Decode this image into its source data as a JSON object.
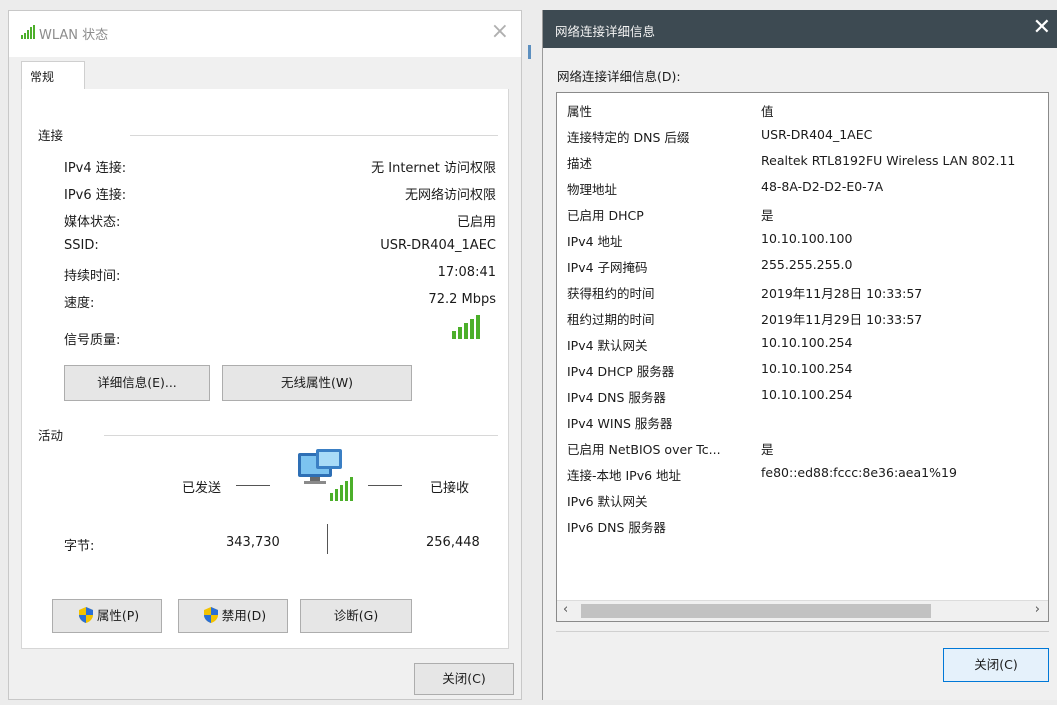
{
  "left_window": {
    "title": "WLAN 状态",
    "close_glyph": "×",
    "tab": "常规",
    "connection_section": "连接",
    "connection_rows": [
      {
        "label": "IPv4 连接:",
        "value": "无 Internet 访问权限"
      },
      {
        "label": "IPv6 连接:",
        "value": "无网络访问权限"
      },
      {
        "label": "媒体状态:",
        "value": "已启用"
      },
      {
        "label": "SSID:",
        "value": "USR-DR404_1AEC"
      },
      {
        "label": "持续时间:",
        "value": "17:08:41"
      },
      {
        "label": "速度:",
        "value": "72.2 Mbps"
      }
    ],
    "signal_label": "信号质量:",
    "signal_bars": 5,
    "details_button": "详细信息(E)...",
    "wireless_props_button": "无线属性(W)",
    "activity_section": "活动",
    "sent_label": "已发送",
    "received_label": "已接收",
    "bytes_label": "字节:",
    "bytes_sent": "343,730",
    "bytes_received": "256,448",
    "properties_button": "属性(P)",
    "disable_button": "禁用(D)",
    "diagnose_button": "诊断(G)",
    "close_button": "关闭(C)"
  },
  "right_window": {
    "title": "网络连接详细信息",
    "close_glyph": "✕",
    "group_label": "网络连接详细信息(D):",
    "rows": [
      {
        "prop": "属性",
        "value": "值"
      },
      {
        "prop": "连接特定的 DNS 后缀",
        "value": "USR-DR404_1AEC"
      },
      {
        "prop": "描述",
        "value": "Realtek RTL8192FU Wireless LAN 802.11"
      },
      {
        "prop": "物理地址",
        "value": "48-8A-D2-D2-E0-7A"
      },
      {
        "prop": "已启用 DHCP",
        "value": "是"
      },
      {
        "prop": "IPv4 地址",
        "value": "10.10.100.100"
      },
      {
        "prop": "IPv4 子网掩码",
        "value": "255.255.255.0"
      },
      {
        "prop": "获得租约的时间",
        "value": "2019年11月28日 10:33:57"
      },
      {
        "prop": "租约过期的时间",
        "value": "2019年11月29日 10:33:57"
      },
      {
        "prop": "IPv4 默认网关",
        "value": "10.10.100.254"
      },
      {
        "prop": "IPv4 DHCP 服务器",
        "value": "10.10.100.254"
      },
      {
        "prop": "IPv4 DNS 服务器",
        "value": "10.10.100.254"
      },
      {
        "prop": "IPv4 WINS 服务器",
        "value": ""
      },
      {
        "prop": "已启用 NetBIOS over Tc...",
        "value": "是"
      },
      {
        "prop": "连接-本地 IPv6 地址",
        "value": "fe80::ed88:fccc:8e36:aea1%19"
      },
      {
        "prop": "IPv6 默认网关",
        "value": ""
      },
      {
        "prop": "IPv6 DNS 服务器",
        "value": ""
      }
    ],
    "scroll_left": "‹",
    "scroll_right": "›",
    "close_button": "关闭(C)"
  },
  "colors": {
    "accent": "#0078d7",
    "signal_green": "#4caf2a",
    "titlebar_dark": "#3d4a52"
  }
}
